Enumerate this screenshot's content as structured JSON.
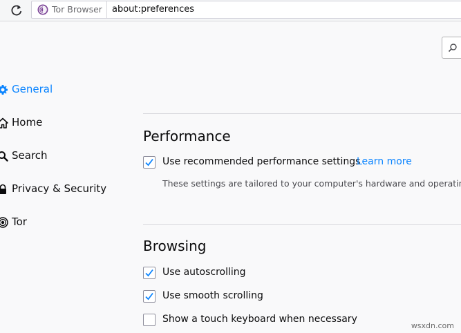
{
  "toolbar": {
    "identity_label": "Tor Browser",
    "url": "about:preferences"
  },
  "sidebar": {
    "items": [
      {
        "label": "General",
        "icon": "gear-icon",
        "active": true
      },
      {
        "label": "Home",
        "icon": "home-icon",
        "active": false
      },
      {
        "label": "Search",
        "icon": "search-icon",
        "active": false
      },
      {
        "label": "Privacy & Security",
        "icon": "lock-icon",
        "active": false
      },
      {
        "label": "Tor",
        "icon": "onion-icon",
        "active": false
      }
    ]
  },
  "performance": {
    "title": "Performance",
    "recommended_label": "Use recommended performance settings",
    "recommended_checked": true,
    "learn_more": "Learn more",
    "hint": "These settings are tailored to your computer's hardware and operating"
  },
  "browsing": {
    "title": "Browsing",
    "options": [
      {
        "label": "Use autoscrolling",
        "checked": true
      },
      {
        "label": "Use smooth scrolling",
        "checked": true
      },
      {
        "label": "Show a touch keyboard when necessary",
        "checked": false
      }
    ]
  },
  "watermark": "wsxdn.com",
  "colors": {
    "accent": "#0a84ff",
    "tor_purple": "#7d4698",
    "check_blue": "#0a84ff"
  }
}
